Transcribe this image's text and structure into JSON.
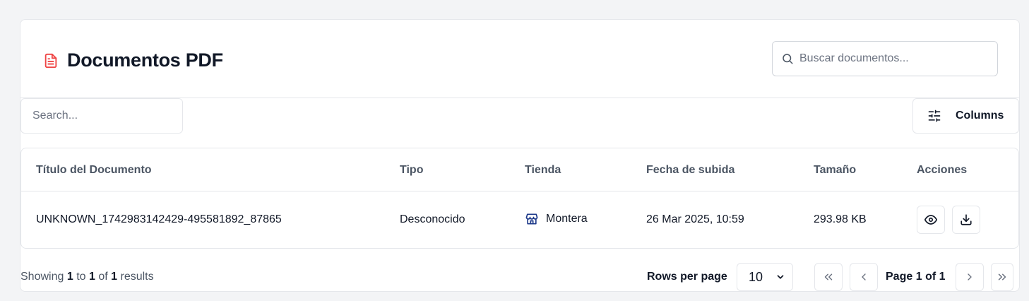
{
  "header": {
    "title": "Documentos PDF",
    "title_icon": "file-text-icon",
    "title_icon_color": "#ef4444",
    "search_placeholder": "Buscar documentos..."
  },
  "toolbar": {
    "search_placeholder": "Search...",
    "columns_label": "Columns",
    "columns_icon": "sliders-icon"
  },
  "table": {
    "columns": [
      "Título del Documento",
      "Tipo",
      "Tienda",
      "Fecha de subida",
      "Tamaño",
      "Acciones"
    ],
    "rows": [
      {
        "title": "UNKNOWN_1742983142429-495581892_87865",
        "type": "Desconocido",
        "store": "Montera",
        "store_icon": "store-icon",
        "store_icon_color": "#1e3a8a",
        "date": "26 Mar 2025, 10:59",
        "size": "293.98 KB",
        "actions": [
          "eye-icon",
          "download-icon"
        ]
      }
    ]
  },
  "footer": {
    "showing_prefix": "Showing",
    "from": "1",
    "to_word": "to",
    "to": "1",
    "of_word": "of",
    "total": "1",
    "results_word": "results",
    "rows_per_page_label": "Rows per page",
    "rows_per_page_value": "10",
    "page_word": "Page",
    "current_page": "1",
    "page_of_word": "of",
    "total_pages": "1"
  }
}
